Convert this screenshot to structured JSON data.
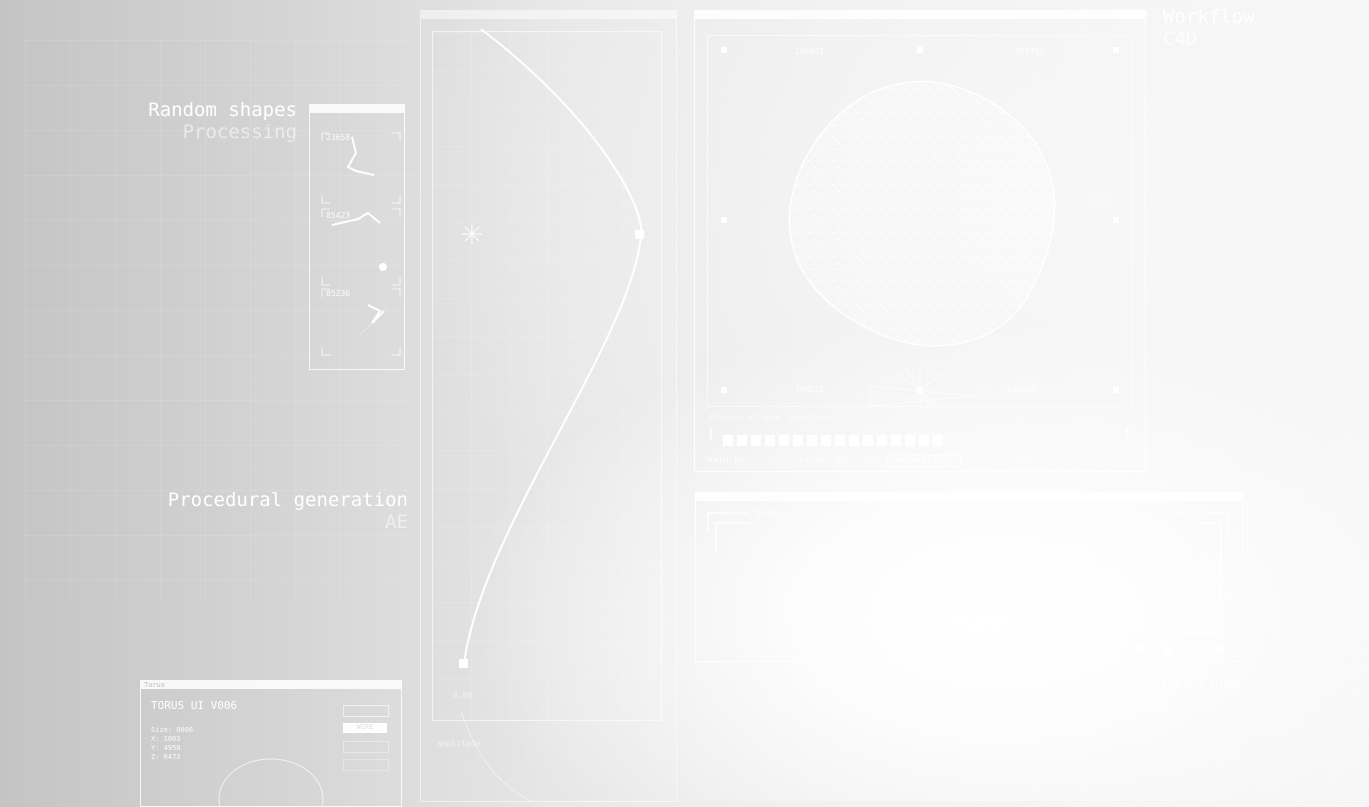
{
  "labels": {
    "random_shapes": {
      "title": "Random shapes",
      "tool": "Processing"
    },
    "procedural": {
      "title": "Procedural generation",
      "tool": "AE"
    },
    "workflow_top": {
      "title": "Workflow",
      "tool": "C4D"
    },
    "workflow_bottom": {
      "title": "Workflow",
      "tool": "AE"
    }
  },
  "shapes_panel": {
    "readouts": [
      "23658",
      "85423",
      "85236"
    ]
  },
  "curve_panel": {
    "bottom_label": "0.00",
    "footer_label": "amplitude"
  },
  "sphere_panel": {
    "corner_values": [
      "146642",
      "389753",
      "748271",
      "838525"
    ],
    "progress_label": "Process of some Importance",
    "progress_left_bracket": "[",
    "progress_right_bracket": "]",
    "progress_filled_segments": 16,
    "tabs": [
      "main.py",
      "render.py",
      "geometry.py"
    ]
  },
  "wave_panel": {
    "left_value": "23453",
    "right_value": "5263"
  },
  "torus_panel": {
    "window_title": "Torus",
    "heading": "TORUS UI V006",
    "stats": [
      "Size: 0006",
      "X: 1063",
      "Y: 4958",
      "Z: 0473"
    ],
    "buttons": [
      "",
      "WIRE",
      "",
      ""
    ]
  },
  "colors": {
    "accent": "#ffffff",
    "background_left": "#c4c4c4",
    "background_right": "#f6f6f6"
  }
}
